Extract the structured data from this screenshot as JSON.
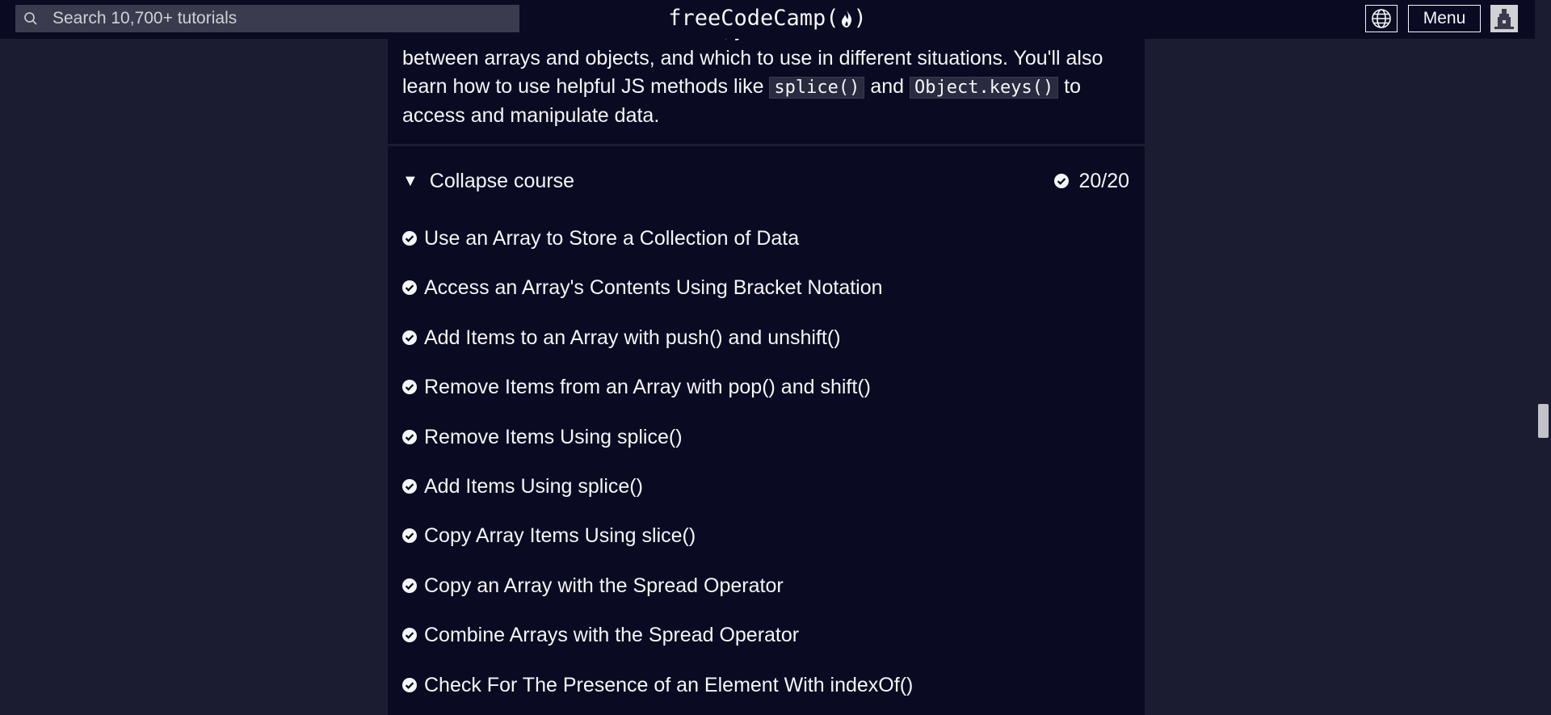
{
  "nav": {
    "search_placeholder": "Search 10,700+ tutorials",
    "brand_text": "freeCodeCamp(",
    "brand_close": ")",
    "menu_label": "Menu"
  },
  "course": {
    "description_line1": "In this Basic Data Structures course, you'll learn more about the differences",
    "description_line2": "between arrays and objects, and which to use in different situations. You'll also",
    "description_line3a": "learn how to use helpful JS methods like ",
    "code1": "splice()",
    "description_and": " and ",
    "code2": "Object.keys()",
    "description_line3b": " to",
    "description_line4": "access and manipulate data.",
    "collapse_label": "Collapse course",
    "progress": "20/20",
    "lessons": [
      "Use an Array to Store a Collection of Data",
      "Access an Array's Contents Using Bracket Notation",
      "Add Items to an Array with push() and unshift()",
      "Remove Items from an Array with pop() and shift()",
      "Remove Items Using splice()",
      "Add Items Using splice()",
      "Copy Array Items Using slice()",
      "Copy an Array with the Spread Operator",
      "Combine Arrays with the Spread Operator",
      "Check For The Presence of an Element With indexOf()"
    ]
  },
  "colors": {
    "nav_bg": "#0a0a23",
    "page_bg": "#1b1b32",
    "search_bg": "#3b3b4f",
    "text": "#f5f6f7"
  }
}
